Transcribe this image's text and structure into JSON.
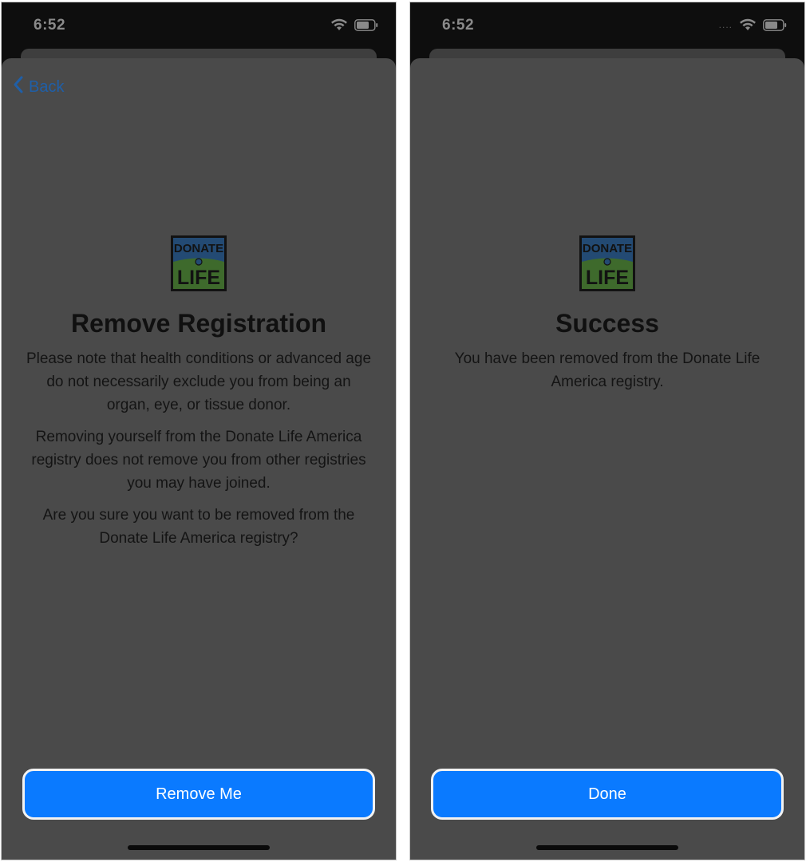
{
  "left_screen": {
    "status_time": "6:52",
    "back_label": "Back",
    "logo": {
      "line1": "DONATE",
      "line2": "LIFE"
    },
    "title": "Remove Registration",
    "paragraphs": [
      "Please note that health conditions or advanced age do not necessarily exclude you from being an organ, eye, or tissue donor.",
      "Removing yourself from the Donate Life America registry does not remove you from other registries you may have joined.",
      "Are you sure you want to be removed from the Donate Life America registry?"
    ],
    "button_label": "Remove Me"
  },
  "right_screen": {
    "status_time": "6:52",
    "signal_dots": "....",
    "logo": {
      "line1": "DONATE",
      "line2": "LIFE"
    },
    "title": "Success",
    "paragraphs": [
      "You have been removed from the Donate Life America registry."
    ],
    "button_label": "Done"
  },
  "icons": {
    "back": "chevron-left-icon",
    "wifi": "wifi-icon",
    "battery": "battery-icon",
    "logo": "donate-life-logo"
  },
  "colors": {
    "accent_button": "#0a7aff",
    "back_link": "#1f5fa8",
    "sheet_background": "#4a4a4a",
    "logo_blue": "#234a73",
    "logo_green": "#3e6a2c"
  }
}
